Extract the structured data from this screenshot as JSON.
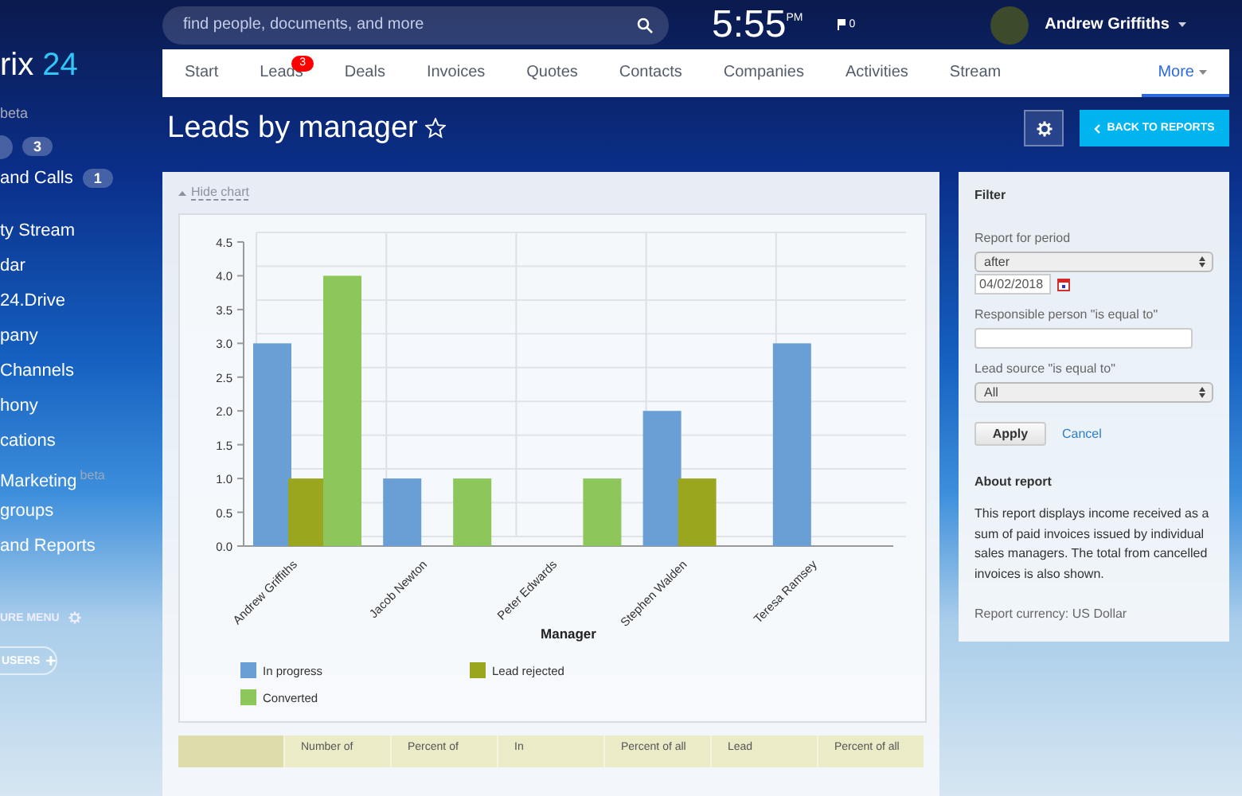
{
  "sidebar": {
    "logo": {
      "text": "rix",
      "accent": "24"
    },
    "note": "beta",
    "counters": [
      "3"
    ],
    "calls": {
      "label": "and Calls",
      "badge": "1"
    },
    "items": [
      {
        "label": "ty Stream"
      },
      {
        "label": "dar"
      },
      {
        "label": "24.Drive"
      },
      {
        "label": "pany"
      },
      {
        "label": " Channels"
      },
      {
        "label": "hony"
      },
      {
        "label": "cations"
      },
      {
        "label": "Marketing",
        "sup": "beta"
      },
      {
        "label": "groups"
      },
      {
        "label": "and Reports"
      }
    ],
    "configure": "URE MENU",
    "invite": "USERS"
  },
  "top_bar": {
    "search": {
      "placeholder": "find people, documents, and more"
    },
    "time": "5:55",
    "ampm": "PM",
    "flags": "0",
    "user": "Andrew Griffiths"
  },
  "tabs": [
    {
      "label": "Start",
      "selected": false
    },
    {
      "label": "Leads",
      "selected": false,
      "badge": "3"
    },
    {
      "label": "Deals",
      "selected": false
    },
    {
      "label": "Invoices",
      "selected": false
    },
    {
      "label": "Quotes",
      "selected": false
    },
    {
      "label": "Contacts",
      "selected": false
    },
    {
      "label": "Companies",
      "selected": false
    },
    {
      "label": "Activities",
      "selected": false
    },
    {
      "label": "Stream",
      "selected": false
    },
    {
      "label": "More",
      "selected": true
    }
  ],
  "page": {
    "title": "Leads by manager",
    "back": "BACK TO REPORTS"
  },
  "report": {
    "hide_chart": "Hide chart",
    "chart_data": {
      "type": "bar",
      "xlabel": "Manager",
      "categories": [
        "Andrew Griffiths",
        "Jacob Newton",
        "Peter Edwards",
        "Stephen Walden",
        "Teresa Ramsey"
      ],
      "series": [
        {
          "name": "In progress",
          "color": "#6a9fd6",
          "values": [
            3,
            1,
            0,
            2,
            3
          ]
        },
        {
          "name": "Lead rejected",
          "color": "#9aa71e",
          "values": [
            1,
            0,
            0,
            1,
            0
          ]
        },
        {
          "name": "Converted",
          "color": "#8dc65a",
          "values": [
            4,
            1,
            1,
            0,
            0
          ]
        }
      ],
      "legend": true,
      "ylim": [
        0,
        4.5
      ],
      "yticks": [
        {
          "value": 0,
          "label": "0.0"
        },
        {
          "value": 0.5,
          "label": "0.5"
        },
        {
          "value": 1,
          "label": "1.0"
        },
        {
          "value": 1.5,
          "label": "1.5"
        },
        {
          "value": 2,
          "label": "2.0"
        },
        {
          "value": 2.5,
          "label": "2.5"
        },
        {
          "value": 3,
          "label": "3.0"
        },
        {
          "value": 3.5,
          "label": "3.5"
        },
        {
          "value": 4,
          "label": "4.0"
        },
        {
          "value": 4.5,
          "label": "4.5"
        }
      ]
    },
    "table_columns": [
      "Number of",
      "Percent of",
      "In",
      "Percent of all",
      "Lead",
      "Percent of all"
    ]
  },
  "filter": {
    "title": "Filter",
    "period_label": "Report for period",
    "period": "after",
    "date": "04/02/2018",
    "person_label": "Responsible person \"is equal to\"",
    "source_label": "Lead source \"is equal to\"",
    "source": "All",
    "apply": "Apply",
    "cancel": "Cancel",
    "about_title": "About report",
    "about": "This report displays income received as a sum of paid invoices issued by individual sales managers. The total from cancelled invoices is also shown.",
    "currency": "Report currency: US Dollar"
  }
}
